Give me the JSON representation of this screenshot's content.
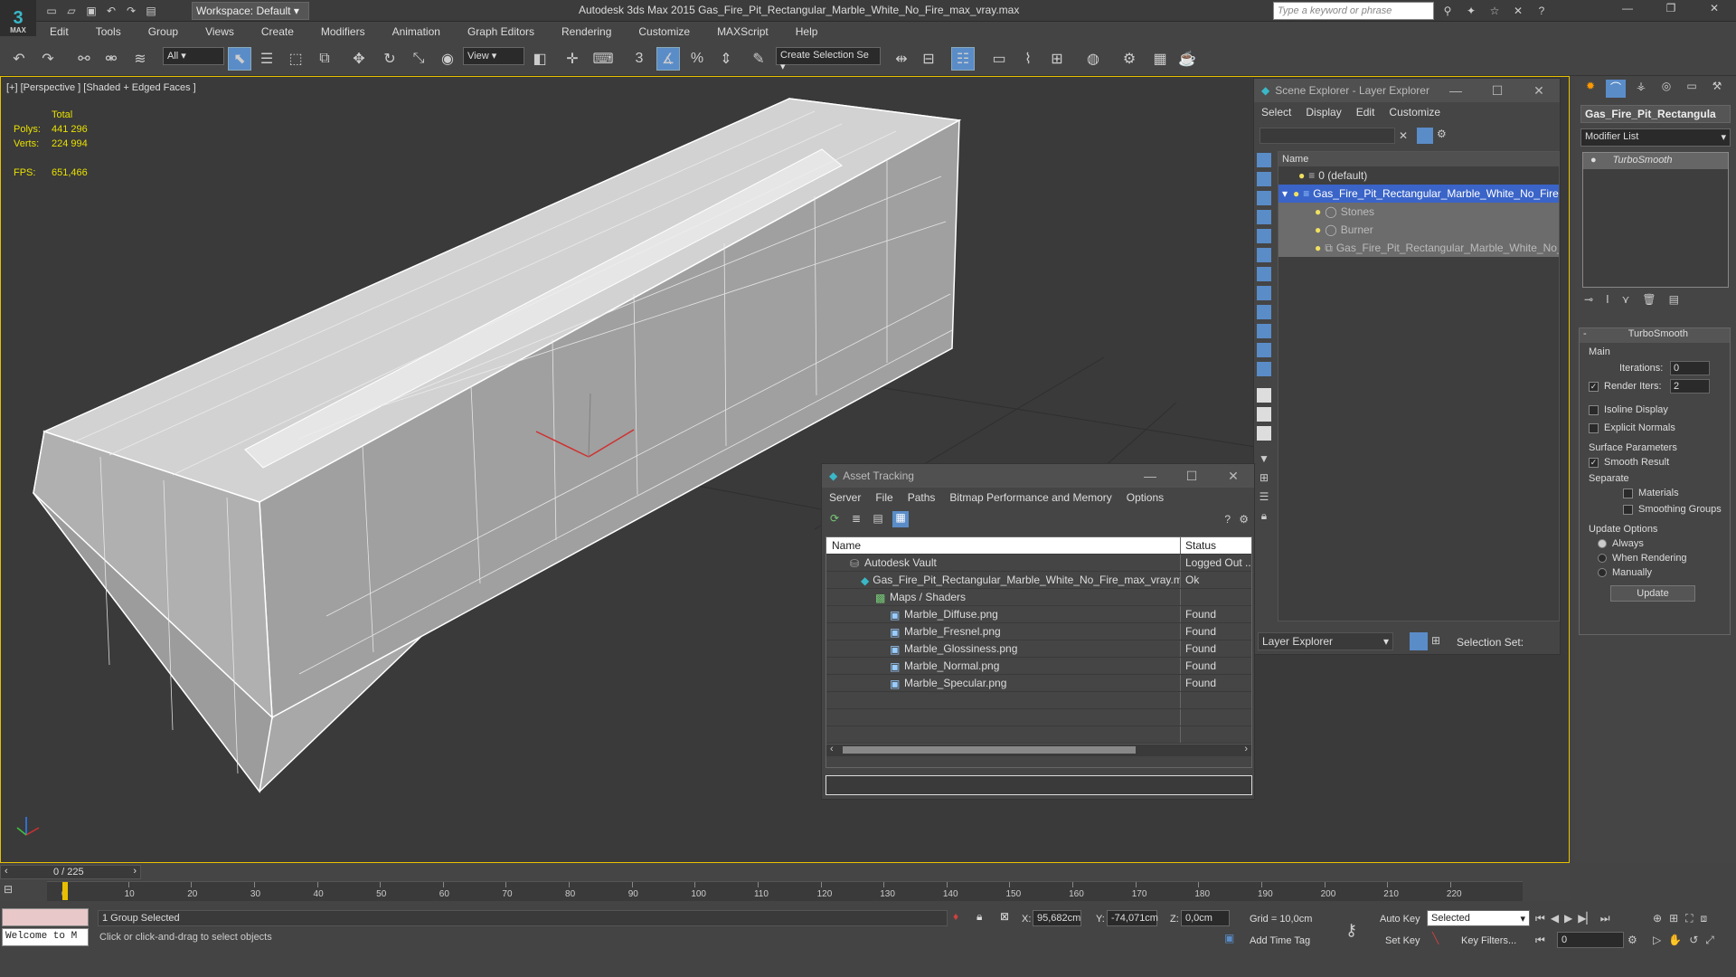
{
  "app": {
    "logo_text": "3",
    "logo_sub": "MAX",
    "workspace": "Workspace: Default",
    "window_title": "Autodesk 3ds Max  2015     Gas_Fire_Pit_Rectangular_Marble_White_No_Fire_max_vray.max",
    "search_placeholder": "Type a keyword or phrase"
  },
  "menu": [
    "Edit",
    "Tools",
    "Group",
    "Views",
    "Create",
    "Modifiers",
    "Animation",
    "Graph Editors",
    "Rendering",
    "Customize",
    "MAXScript",
    "Help"
  ],
  "toolbar": {
    "filter_value": "All",
    "ref_coord_value": "View",
    "selection_set_placeholder": "Create Selection Se"
  },
  "viewport": {
    "label": "[+] [Perspective ] [Shaded + Edged Faces ]",
    "stats_total": "Total",
    "polys_label": "Polys:",
    "polys_value": "441 296",
    "verts_label": "Verts:",
    "verts_value": "224 994",
    "fps_label": "FPS:",
    "fps_value": "651,466"
  },
  "scene_explorer": {
    "title": "Scene Explorer - Layer Explorer",
    "menu": [
      "Select",
      "Display",
      "Edit",
      "Customize"
    ],
    "column_name": "Name",
    "items": [
      {
        "label": "0 (default)",
        "level": 0
      },
      {
        "label": "Gas_Fire_Pit_Rectangular_Marble_White_No_Fire",
        "level": 0
      },
      {
        "label": "Stones",
        "level": 1
      },
      {
        "label": "Burner",
        "level": 1
      },
      {
        "label": "Gas_Fire_Pit_Rectangular_Marble_White_No_...",
        "level": 1
      }
    ],
    "footer_dropdown": "Layer Explorer",
    "selection_set_label": "Selection Set:"
  },
  "asset_tracking": {
    "title": "Asset Tracking",
    "menu": [
      "Server",
      "File",
      "Paths",
      "Bitmap Performance and Memory",
      "Options"
    ],
    "col_name": "Name",
    "col_status": "Status",
    "rows": [
      {
        "name": "Autodesk Vault",
        "status": "Logged Out ..."
      },
      {
        "name": "Gas_Fire_Pit_Rectangular_Marble_White_No_Fire_max_vray.m...",
        "status": "Ok"
      },
      {
        "name": "Maps / Shaders",
        "status": ""
      },
      {
        "name": "Marble_Diffuse.png",
        "status": "Found"
      },
      {
        "name": "Marble_Fresnel.png",
        "status": "Found"
      },
      {
        "name": "Marble_Glossiness.png",
        "status": "Found"
      },
      {
        "name": "Marble_Normal.png",
        "status": "Found"
      },
      {
        "name": "Marble_Specular.png",
        "status": "Found"
      }
    ]
  },
  "command_panel": {
    "object_name": "Gas_Fire_Pit_Rectangula",
    "modifier_list": "Modifier List",
    "stack_item": "TurboSmooth",
    "rollout_title": "TurboSmooth",
    "main_label": "Main",
    "iterations_label": "Iterations:",
    "iterations_value": "0",
    "render_iters_label": "Render Iters:",
    "render_iters_value": "2",
    "isoline_label": "Isoline Display",
    "explicit_normals_label": "Explicit Normals",
    "surface_params_label": "Surface Parameters",
    "smooth_result_label": "Smooth Result",
    "separate_label": "Separate",
    "materials_label": "Materials",
    "smoothing_groups_label": "Smoothing Groups",
    "update_options_label": "Update Options",
    "always_label": "Always",
    "when_rendering_label": "When Rendering",
    "manually_label": "Manually",
    "update_button": "Update"
  },
  "timeline": {
    "frame_display": "0 / 225",
    "ticks": [
      "0",
      "10",
      "20",
      "30",
      "40",
      "50",
      "60",
      "70",
      "80",
      "90",
      "100",
      "110",
      "120",
      "130",
      "140",
      "150",
      "160",
      "170",
      "180",
      "190",
      "200",
      "210",
      "220"
    ],
    "current_frame_fraction": 0
  },
  "status": {
    "listener": "Welcome to M",
    "selection": "1 Group Selected",
    "prompt": "Click or click-and-drag to select objects",
    "x_label": "X:",
    "x_value": "95,682cm",
    "y_label": "Y:",
    "y_value": "-74,071cm",
    "z_label": "Z:",
    "z_value": "0,0cm",
    "grid": "Grid = 10,0cm",
    "add_time_tag": "Add Time Tag",
    "auto_key": "Auto Key",
    "set_key": "Set Key",
    "selected_dropdown": "Selected",
    "key_filters": "Key Filters...",
    "frame_field": "0"
  }
}
